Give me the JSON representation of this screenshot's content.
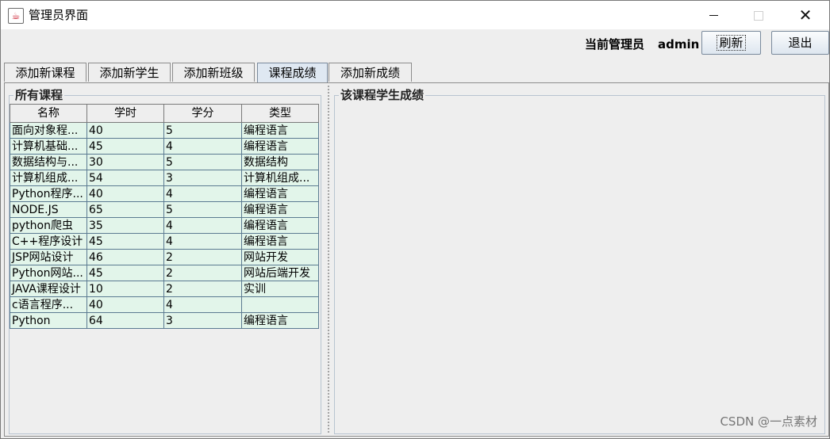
{
  "window": {
    "title": "管理员界面",
    "icon": "java-cup-icon"
  },
  "header": {
    "admin_label": "当前管理员",
    "admin_name": "admin",
    "refresh_label": "刷新",
    "exit_label": "退出"
  },
  "tabs": [
    {
      "label": "添加新课程",
      "active": false
    },
    {
      "label": "添加新学生",
      "active": false
    },
    {
      "label": "添加新班级",
      "active": false
    },
    {
      "label": "课程成绩",
      "active": true
    },
    {
      "label": "添加新成绩",
      "active": false
    }
  ],
  "left_panel": {
    "title": "所有课程",
    "columns": [
      "名称",
      "学时",
      "学分",
      "类型"
    ],
    "rows": [
      [
        "面向对象程...",
        "40",
        "5",
        "编程语言"
      ],
      [
        "计算机基础...",
        "45",
        "4",
        "编程语言"
      ],
      [
        "数据结构与...",
        "30",
        "5",
        "数据结构"
      ],
      [
        "计算机组成...",
        "54",
        "3",
        "计算机组成..."
      ],
      [
        "Python程序...",
        "40",
        "4",
        "编程语言"
      ],
      [
        "NODE.JS",
        "65",
        "5",
        "编程语言"
      ],
      [
        "python爬虫",
        "35",
        "4",
        "编程语言"
      ],
      [
        "C++程序设计",
        "45",
        "4",
        "编程语言"
      ],
      [
        "JSP网站设计",
        "46",
        "2",
        "网站开发"
      ],
      [
        "Python网站...",
        "45",
        "2",
        "网站后端开发"
      ],
      [
        "JAVA课程设计",
        "10",
        "2",
        "实训"
      ],
      [
        "c语言程序...",
        "40",
        "4",
        ""
      ],
      [
        "Python",
        "64",
        "3",
        "编程语言"
      ]
    ]
  },
  "right_panel": {
    "title": "该课程学生成绩"
  },
  "watermark": "CSDN @一点素材",
  "colors": {
    "row_bg": "#e2f5ea",
    "active_tab": "#dfe8f2"
  }
}
